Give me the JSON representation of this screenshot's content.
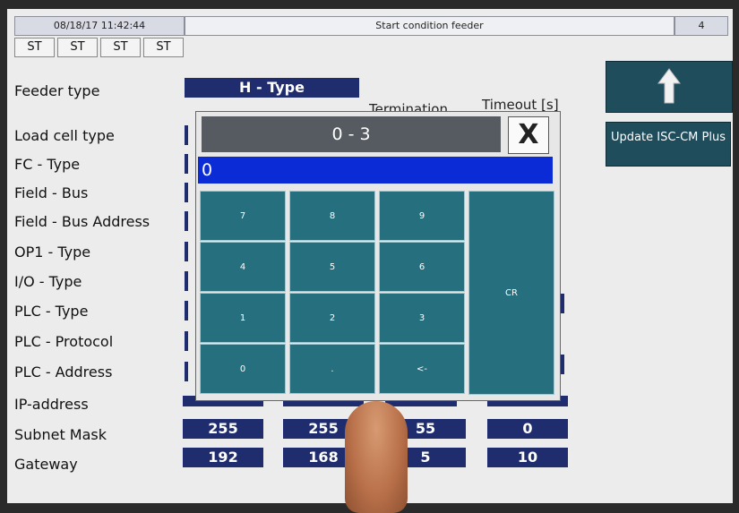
{
  "header": {
    "datetime": "08/18/17 11:42:44",
    "title": "Start condition feeder",
    "page_number": "4"
  },
  "status_tabs": [
    "ST",
    "ST",
    "ST",
    "ST"
  ],
  "fields": {
    "feeder_type": {
      "label": "Feeder type",
      "value": "H - Type"
    },
    "load_cell_type": {
      "label": "Load cell type"
    },
    "fc_type": {
      "label": "FC - Type"
    },
    "field_bus": {
      "label": "Field - Bus"
    },
    "field_bus_address": {
      "label": "Field - Bus Address"
    },
    "op1_type": {
      "label": "OP1 - Type"
    },
    "io_type": {
      "label": "I/O - Type"
    },
    "plc_type": {
      "label": "PLC - Type"
    },
    "plc_protocol": {
      "label": "PLC - Protocol"
    },
    "plc_address": {
      "label": "PLC - Address"
    },
    "ip_address": {
      "label": "IP-address"
    },
    "subnet_mask": {
      "label": "Subnet Mask",
      "octets": [
        "255",
        "255",
        "55",
        "0"
      ]
    },
    "gateway": {
      "label": "Gateway",
      "octets": [
        "192",
        "168",
        "5",
        "10"
      ]
    }
  },
  "columns": {
    "termination": "Termination",
    "timeout": "Timeout [s]"
  },
  "buttons": {
    "up": "up-arrow",
    "update": "Update ISC-CM Plus"
  },
  "keypad": {
    "range": "0 - 3",
    "close": "X",
    "value": "0",
    "keys": {
      "k7": "7",
      "k8": "8",
      "k9": "9",
      "k4": "4",
      "k5": "5",
      "k6": "6",
      "k1": "1",
      "k2": "2",
      "k3": "3",
      "k0": "0",
      "dot": ".",
      "back": "<-",
      "cr": "CR"
    }
  },
  "colors": {
    "value_field": "#1f2d6e",
    "keypad_key": "#256f7e",
    "input_highlight": "#0b2bd6",
    "side_button": "#1f4d5c"
  }
}
